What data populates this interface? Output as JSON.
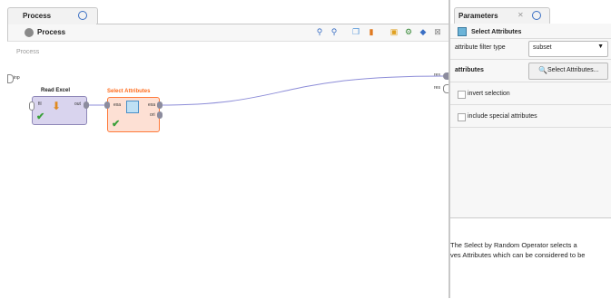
{
  "process_tab": {
    "label": "Process"
  },
  "process_header": {
    "label": "Process"
  },
  "toolbar": {
    "icons": [
      "zoom-in-icon",
      "zoom-out-icon",
      "copy-icon",
      "folder-icon",
      "add-icon",
      "settings-icon",
      "cube-icon",
      "fit-icon"
    ]
  },
  "canvas": {
    "process_label": "Process",
    "left_port": "inp",
    "right_ports": [
      "res",
      "res"
    ]
  },
  "operators": [
    {
      "title": "Read Excel",
      "in_ports": [
        "fil"
      ],
      "out_ports": [
        "out"
      ]
    },
    {
      "title": "Select Attributes",
      "in_ports": [
        "exa"
      ],
      "out_ports": [
        "exa",
        "ori"
      ]
    }
  ],
  "parameters_tab": {
    "label": "Parameters",
    "close": "✕"
  },
  "parameters": {
    "operator_name": "Select Attributes",
    "filter_type_label": "attribute filter type",
    "filter_type_value": "subset",
    "attributes_label": "attributes",
    "attributes_button": "Select Attributes...",
    "invert_label": "invert selection",
    "special_label": "include special attributes"
  },
  "help": {
    "line1": "The Select by Random Operator selects a",
    "line2": "ves Attributes which can be considered to be"
  },
  "colors": {
    "accent": "#3a6fc4",
    "selected_operator": "#ff7a3a",
    "wire": "#8d8dd8"
  }
}
